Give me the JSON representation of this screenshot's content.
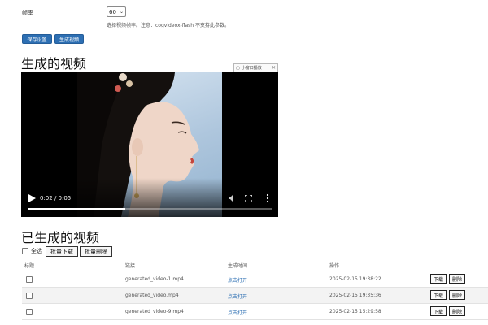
{
  "settings": {
    "fps_label": "帧率",
    "fps_value": "60",
    "fps_hint": "选择视频帧率。注意：cogvideox-flash 不支持此参数。",
    "save_label": "保存设置",
    "generate_label": "生成视频"
  },
  "player_section": {
    "title": "生成的视频",
    "float_badge": "小窗口播放",
    "time": "0:02 / 0:05",
    "progress": 0.4
  },
  "list_section": {
    "title": "已生成的视频",
    "select_all": "全选",
    "batch_download": "批量下载",
    "batch_delete": "批量删除",
    "columns": [
      "标题",
      "链接",
      "生成时间",
      "操作"
    ],
    "rows": [
      {
        "filename": "generated_video-1.mp4",
        "open": "点击打开",
        "time": "2025-02-15 19:38:22",
        "download": "下载",
        "delete": "删除"
      },
      {
        "filename": "generated_video.mp4",
        "open": "点击打开",
        "time": "2025-02-15 19:35:36",
        "download": "下载",
        "delete": "删除"
      },
      {
        "filename": "generated_video-9.mp4",
        "open": "点击打开",
        "time": "2025-02-15 15:29:58",
        "download": "下载",
        "delete": "删除"
      }
    ]
  },
  "colors": {
    "accent": "#2d6fb3",
    "link": "#2d6fb3"
  }
}
